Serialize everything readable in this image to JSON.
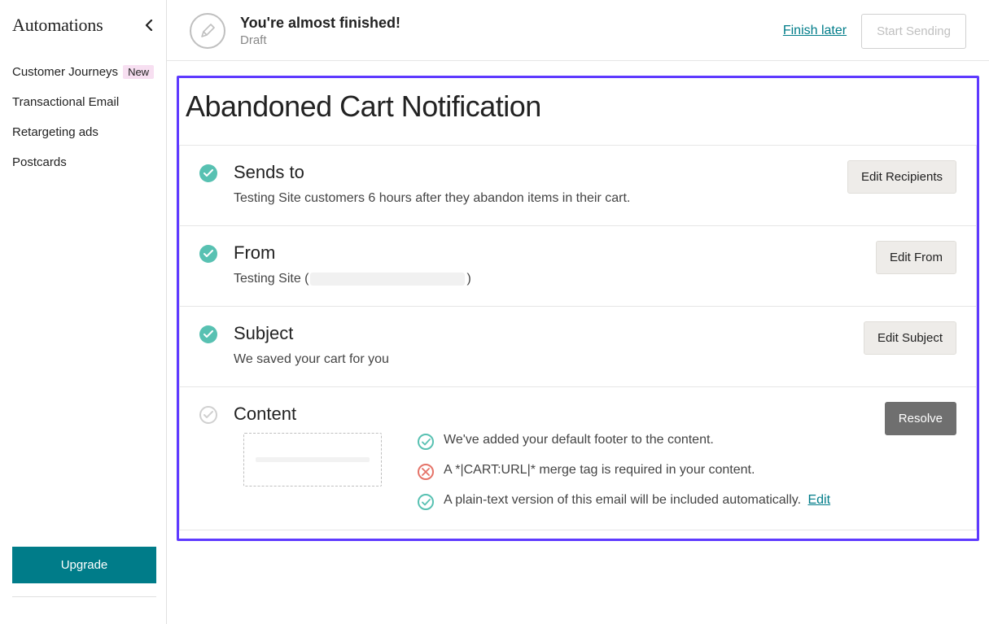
{
  "sidebar": {
    "title": "Automations",
    "items": [
      {
        "label": "Customer Journeys",
        "badge": "New"
      },
      {
        "label": "Transactional Email"
      },
      {
        "label": "Retargeting ads"
      },
      {
        "label": "Postcards"
      }
    ],
    "upgrade_label": "Upgrade"
  },
  "topbar": {
    "title": "You're almost finished!",
    "subtitle": "Draft",
    "finish_link": "Finish later",
    "start_button": "Start Sending"
  },
  "page": {
    "title": "Abandoned Cart Notification"
  },
  "sections": {
    "sends_to": {
      "title": "Sends to",
      "desc": "Testing Site customers 6 hours after they abandon items in their cart.",
      "button": "Edit Recipients"
    },
    "from": {
      "title": "From",
      "desc_prefix": "Testing Site (",
      "desc_suffix": ")",
      "button": "Edit From"
    },
    "subject": {
      "title": "Subject",
      "desc": "We saved your cart for you",
      "button": "Edit Subject"
    },
    "content": {
      "title": "Content",
      "button": "Resolve",
      "checks": [
        {
          "status": "ok",
          "text": "We've added your default footer to the content."
        },
        {
          "status": "err",
          "text": "A *|CART:URL|* merge tag is required in your content."
        },
        {
          "status": "ok",
          "text": "A plain-text version of this email will be included automatically.",
          "link": "Edit"
        }
      ]
    }
  }
}
